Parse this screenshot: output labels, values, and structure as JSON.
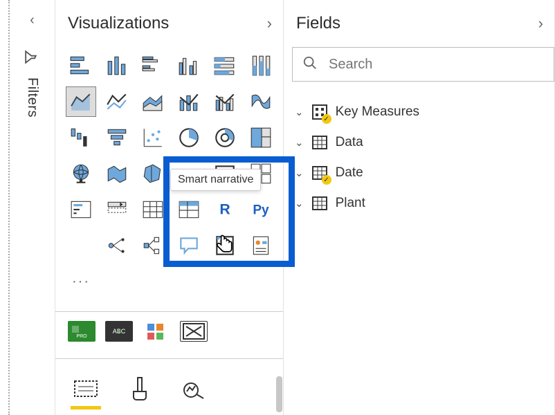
{
  "filters": {
    "label": "Filters"
  },
  "viz": {
    "title": "Visualizations",
    "tooltip": "Smart narrative"
  },
  "fields": {
    "title": "Fields",
    "search_placeholder": "Search",
    "items": [
      {
        "label": "Key Measures",
        "icon": "measure",
        "badge": true
      },
      {
        "label": "Data",
        "icon": "table",
        "badge": false
      },
      {
        "label": "Date",
        "icon": "table",
        "badge": true
      },
      {
        "label": "Plant",
        "icon": "table",
        "badge": false
      }
    ]
  },
  "icons": {
    "stacked_bar_horizontal": "stacked-bar-h",
    "stacked_bar_vertical": "stacked-bar-v",
    "clustered_bar_h": "clustered-bar-h",
    "clustered_bar_v": "clustered-bar-v",
    "stacked100_h": "stacked100-h",
    "stacked100_v": "stacked100-v",
    "area": "area",
    "line": "line",
    "stacked_area": "stacked-area",
    "combo1": "combo1",
    "combo2": "combo2",
    "ribbon": "ribbon",
    "waterfall": "waterfall",
    "funnel": "funnel",
    "scatter": "scatter",
    "pie": "pie",
    "donut": "donut",
    "treemap": "treemap",
    "globe": "globe",
    "filled_map": "filled-map",
    "shape_map": "shape-map",
    "gauge": "gauge",
    "card": "card",
    "multi_card": "multi-card",
    "kpi": "kpi",
    "slicer": "slicer",
    "table": "table",
    "matrix": "matrix",
    "r": "r",
    "py": "py",
    "key_influencers": "key-influencers",
    "decomposition": "decomposition",
    "qna": "qna",
    "smart_narrative": "smart-narrative",
    "paginated": "paginated"
  }
}
